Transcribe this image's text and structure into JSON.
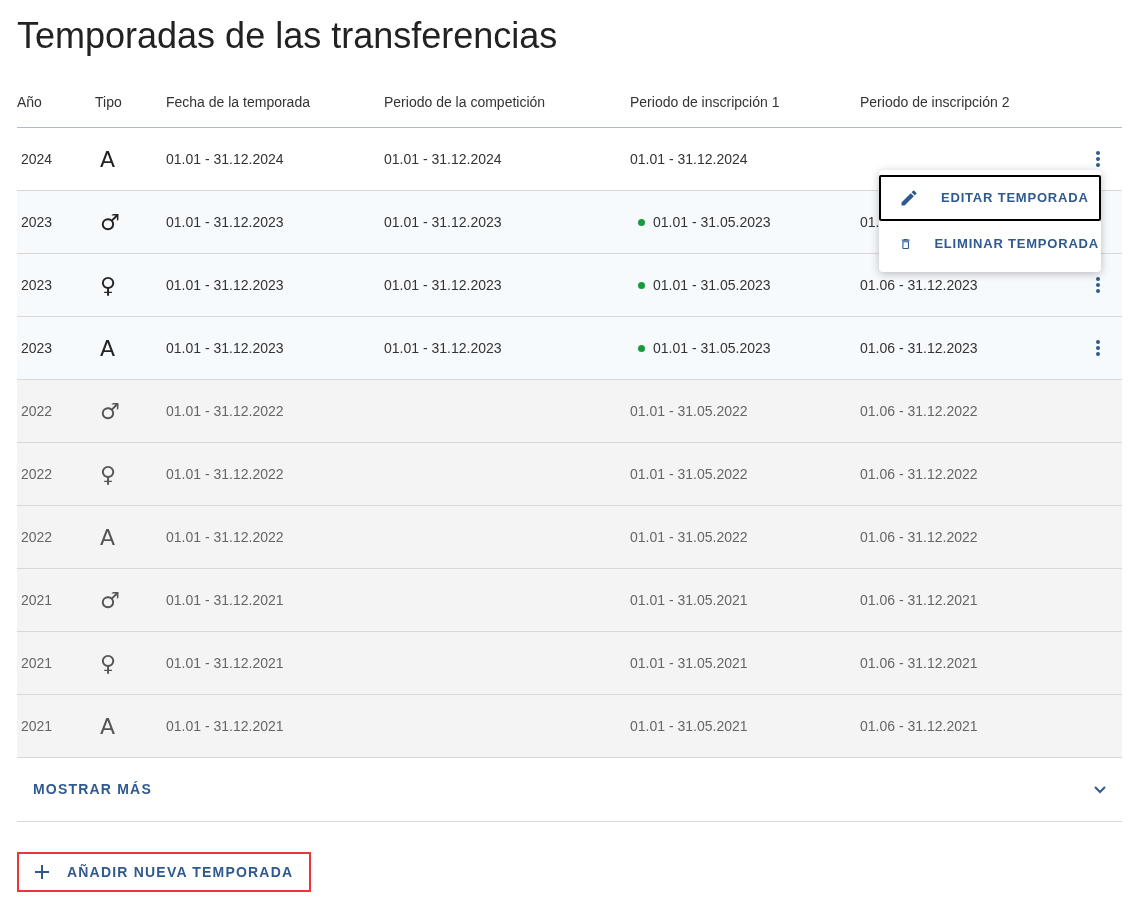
{
  "title": "Temporadas de las transferencias",
  "columns": [
    "Año",
    "Tipo",
    "Fecha de la temporada",
    "Periodo de la competición",
    "Periodo de inscripción 1",
    "Periodo de inscripción 2"
  ],
  "rows": [
    {
      "past": false,
      "year": "2024",
      "type": "A",
      "season": "01.01 - 31.12.2024",
      "competition": "01.01 - 31.12.2024",
      "registration_1": "01.01 - 31.12.2024",
      "registration_1_active": false,
      "menu": true
    },
    {
      "past": false,
      "year": "2023",
      "type": "♂",
      "season": "01.01 - 31.12.2023",
      "competition": "01.01 - 31.12.2023",
      "registration_1": "01.01 - 31.05.2023",
      "registration_1_active": true,
      "registration_2": "01.",
      "menu": false
    },
    {
      "past": false,
      "year": "2023",
      "type": "♀",
      "season": "01.01 - 31.12.2023",
      "competition": "01.01 - 31.12.2023",
      "registration_1": "01.01 - 31.05.2023",
      "registration_1_active": true,
      "registration_2": "01.06 - 31.12.2023",
      "menu": true
    },
    {
      "past": false,
      "year": "2023",
      "type": "A",
      "season": "01.01 - 31.12.2023",
      "competition": "01.01 - 31.12.2023",
      "registration_1": "01.01 - 31.05.2023",
      "registration_1_active": true,
      "registration_2": "01.06 - 31.12.2023",
      "menu": true
    },
    {
      "past": true,
      "year": "2022",
      "type": "♂",
      "season": "01.01 - 31.12.2022",
      "registration_1": "01.01 - 31.05.2022",
      "registration_1_active": false,
      "registration_2": "01.06 - 31.12.2022",
      "menu": false
    },
    {
      "past": true,
      "year": "2022",
      "type": "♀",
      "season": "01.01 - 31.12.2022",
      "registration_1": "01.01 - 31.05.2022",
      "registration_1_active": false,
      "registration_2": "01.06 - 31.12.2022",
      "menu": false
    },
    {
      "past": true,
      "year": "2022",
      "type": "A",
      "season": "01.01 - 31.12.2022",
      "registration_1": "01.01 - 31.05.2022",
      "registration_1_active": false,
      "registration_2": "01.06 - 31.12.2022",
      "menu": false
    },
    {
      "past": true,
      "year": "2021",
      "type": "♂",
      "season": "01.01 - 31.12.2021",
      "registration_1": "01.01 - 31.05.2021",
      "registration_1_active": false,
      "registration_2": "01.06 - 31.12.2021",
      "menu": false
    },
    {
      "past": true,
      "year": "2021",
      "type": "♀",
      "season": "01.01 - 31.12.2021",
      "registration_1": "01.01 - 31.05.2021",
      "registration_1_active": false,
      "registration_2": "01.06 - 31.12.2021",
      "menu": false
    },
    {
      "past": true,
      "year": "2021",
      "type": "A",
      "season": "01.01 - 31.12.2021",
      "registration_1": "01.01 - 31.05.2021",
      "registration_1_active": false,
      "registration_2": "01.06 - 31.12.2021",
      "menu": false
    }
  ],
  "context_menu": [
    {
      "kind": "edit",
      "label": "EDITAR TEMPORADA",
      "selected": true
    },
    {
      "kind": "delete",
      "label": "ELIMINAR TEMPORADA",
      "selected": false
    }
  ],
  "show_more": "MOSTRAR MÁS",
  "add_button": "AÑADIR NUEVA TEMPORADA"
}
